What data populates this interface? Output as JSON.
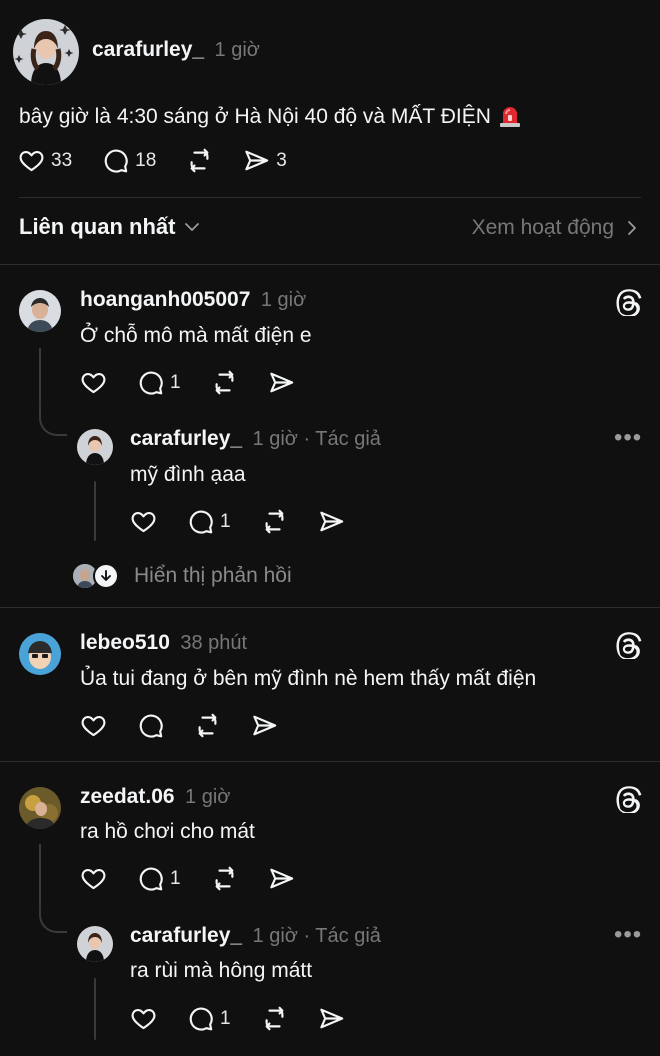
{
  "post": {
    "username": "carafurley_",
    "time": "1 giờ",
    "text": "bây giờ là 4:30 sáng ở Hà Nội 40 độ và MẤT ĐIỆN",
    "emoji": "🚨",
    "likes": "33",
    "comments": "18",
    "shares": "3"
  },
  "sort": {
    "label": "Liên quan nhất",
    "activity": "Xem hoạt động"
  },
  "comments": [
    {
      "username": "hoanganh005007",
      "time": "1 giờ",
      "text": "Ở chỗ mô mà mất điện e",
      "reply_count": "1",
      "reply": {
        "username": "carafurley_",
        "time": "1 giờ · Tác giả",
        "text": "mỹ đình ạaa",
        "reply_count": "1"
      },
      "show_replies": "Hiển thị phản hồi"
    },
    {
      "username": "lebeo510",
      "time": "38 phút",
      "text": "Ủa tui đang ở bên mỹ đình nè hem thấy mất điện"
    },
    {
      "username": "zeedat.06",
      "time": "1 giờ",
      "text": "ra hồ chơi cho mát",
      "reply_count": "1",
      "reply": {
        "username": "carafurley_",
        "time": "1 giờ · Tác giả",
        "text": "ra rùi mà hông mátt",
        "reply_count": "1"
      }
    }
  ],
  "icons": {
    "like": "heart-icon",
    "comment": "comment-icon",
    "repost": "repost-icon",
    "share": "share-icon",
    "threads": "threads-logo-icon",
    "more": "more-icon"
  },
  "colors": {
    "background": "#101010",
    "text": "#f3f5f7",
    "muted": "#777777",
    "divider": "#2d2d2d"
  }
}
